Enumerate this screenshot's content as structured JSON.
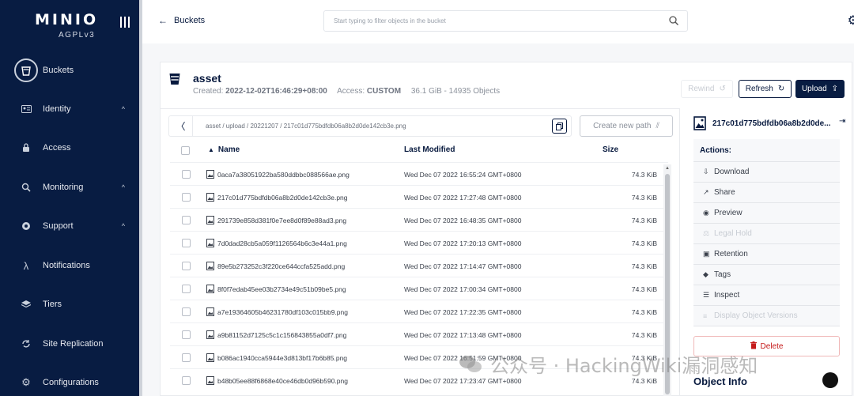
{
  "app": {
    "logo": "MINIO",
    "edition": "AGPLv3"
  },
  "sidebar": {
    "items": [
      {
        "label": "Buckets",
        "icon": "bucket-icon",
        "active": true,
        "chevron": false
      },
      {
        "label": "Identity",
        "icon": "identity-icon",
        "active": false,
        "chevron": true
      },
      {
        "label": "Access",
        "icon": "lock-icon",
        "active": false,
        "chevron": false
      },
      {
        "label": "Monitoring",
        "icon": "monitoring-icon",
        "active": false,
        "chevron": true
      },
      {
        "label": "Support",
        "icon": "support-icon",
        "active": false,
        "chevron": true
      },
      {
        "label": "Notifications",
        "icon": "lambda-icon",
        "active": false,
        "chevron": false
      },
      {
        "label": "Tiers",
        "icon": "tiers-icon",
        "active": false,
        "chevron": false
      },
      {
        "label": "Site Replication",
        "icon": "replication-icon",
        "active": false,
        "chevron": false
      },
      {
        "label": "Configurations",
        "icon": "gear-icon",
        "active": false,
        "chevron": false
      }
    ]
  },
  "topbar": {
    "back_label": "Buckets",
    "search_placeholder": "Start typing to filter objects in the bucket"
  },
  "bucket": {
    "name": "asset",
    "created_label": "Created:",
    "created": "2022-12-02T16:46:29+08:00",
    "access_label": "Access:",
    "access": "CUSTOM",
    "size": "36.1 GiB - 14935 Objects"
  },
  "toolbar": {
    "rewind": "Rewind",
    "refresh": "Refresh",
    "upload": "Upload"
  },
  "path": {
    "text": "asset  /  upload  /  20221207  /  217c01d775bdfdb06a8b2d0de142cb3e.png",
    "new_path": "Create new path"
  },
  "table": {
    "columns": {
      "name": "Name",
      "modified": "Last Modified",
      "size": "Size"
    },
    "rows": [
      {
        "name": "0aca7a38051922ba580ddbbc088566ae.png",
        "modified": "Wed Dec 07 2022 16:55:24 GMT+0800",
        "size": "74.3 KiB"
      },
      {
        "name": "217c01d775bdfdb06a8b2d0de142cb3e.png",
        "modified": "Wed Dec 07 2022 17:27:48 GMT+0800",
        "size": "74.3 KiB"
      },
      {
        "name": "291739e858d381f0e7ee8d0f89e88ad3.png",
        "modified": "Wed Dec 07 2022 16:48:35 GMT+0800",
        "size": "74.3 KiB"
      },
      {
        "name": "7d0dad28cb5a059f1126564b6c3e44a1.png",
        "modified": "Wed Dec 07 2022 17:20:13 GMT+0800",
        "size": "74.3 KiB"
      },
      {
        "name": "89e5b273252c3f220ce644ccfa525add.png",
        "modified": "Wed Dec 07 2022 17:14:47 GMT+0800",
        "size": "74.3 KiB"
      },
      {
        "name": "8f0f7edab45ee03b2734e49c51b09be5.png",
        "modified": "Wed Dec 07 2022 17:00:34 GMT+0800",
        "size": "74.3 KiB"
      },
      {
        "name": "a7e19364605b46231780df103c015bb9.png",
        "modified": "Wed Dec 07 2022 17:22:35 GMT+0800",
        "size": "74.3 KiB"
      },
      {
        "name": "a9b81152d7125c5c1c156843855a0df7.png",
        "modified": "Wed Dec 07 2022 17:13:48 GMT+0800",
        "size": "74.3 KiB"
      },
      {
        "name": "b086ac1940cca5944e3d813bf17b6b85.png",
        "modified": "Wed Dec 07 2022 16:51:59 GMT+0800",
        "size": "74.3 KiB"
      },
      {
        "name": "b48b05ee88f6868e40ce46db0d96b590.png",
        "modified": "Wed Dec 07 2022 17:23:47 GMT+0800",
        "size": "74.3 KiB"
      }
    ]
  },
  "details": {
    "object_name": "217c01d775bdfdb06a8b2d0de...",
    "actions_title": "Actions:",
    "actions": [
      {
        "label": "Download",
        "icon": "download-icon",
        "glyph": "⇩",
        "enabled": true
      },
      {
        "label": "Share",
        "icon": "share-icon",
        "glyph": "↗",
        "enabled": true
      },
      {
        "label": "Preview",
        "icon": "eye-icon",
        "glyph": "◉",
        "enabled": true
      },
      {
        "label": "Legal Hold",
        "icon": "gavel-icon",
        "glyph": "⚖",
        "enabled": false
      },
      {
        "label": "Retention",
        "icon": "retention-icon",
        "glyph": "▣",
        "enabled": true
      },
      {
        "label": "Tags",
        "icon": "tag-icon",
        "glyph": "◆",
        "enabled": true
      },
      {
        "label": "Inspect",
        "icon": "inspect-icon",
        "glyph": "☰",
        "enabled": true
      },
      {
        "label": "Display Object Versions",
        "icon": "versions-icon",
        "glyph": "≡",
        "enabled": false
      }
    ],
    "delete": "Delete",
    "info_title": "Object Info"
  },
  "watermark": "公众号 · HackingWiki漏洞感知",
  "colors": {
    "sidebar": "#081c42",
    "accent": "#081c42",
    "danger": "#c51b1b"
  }
}
